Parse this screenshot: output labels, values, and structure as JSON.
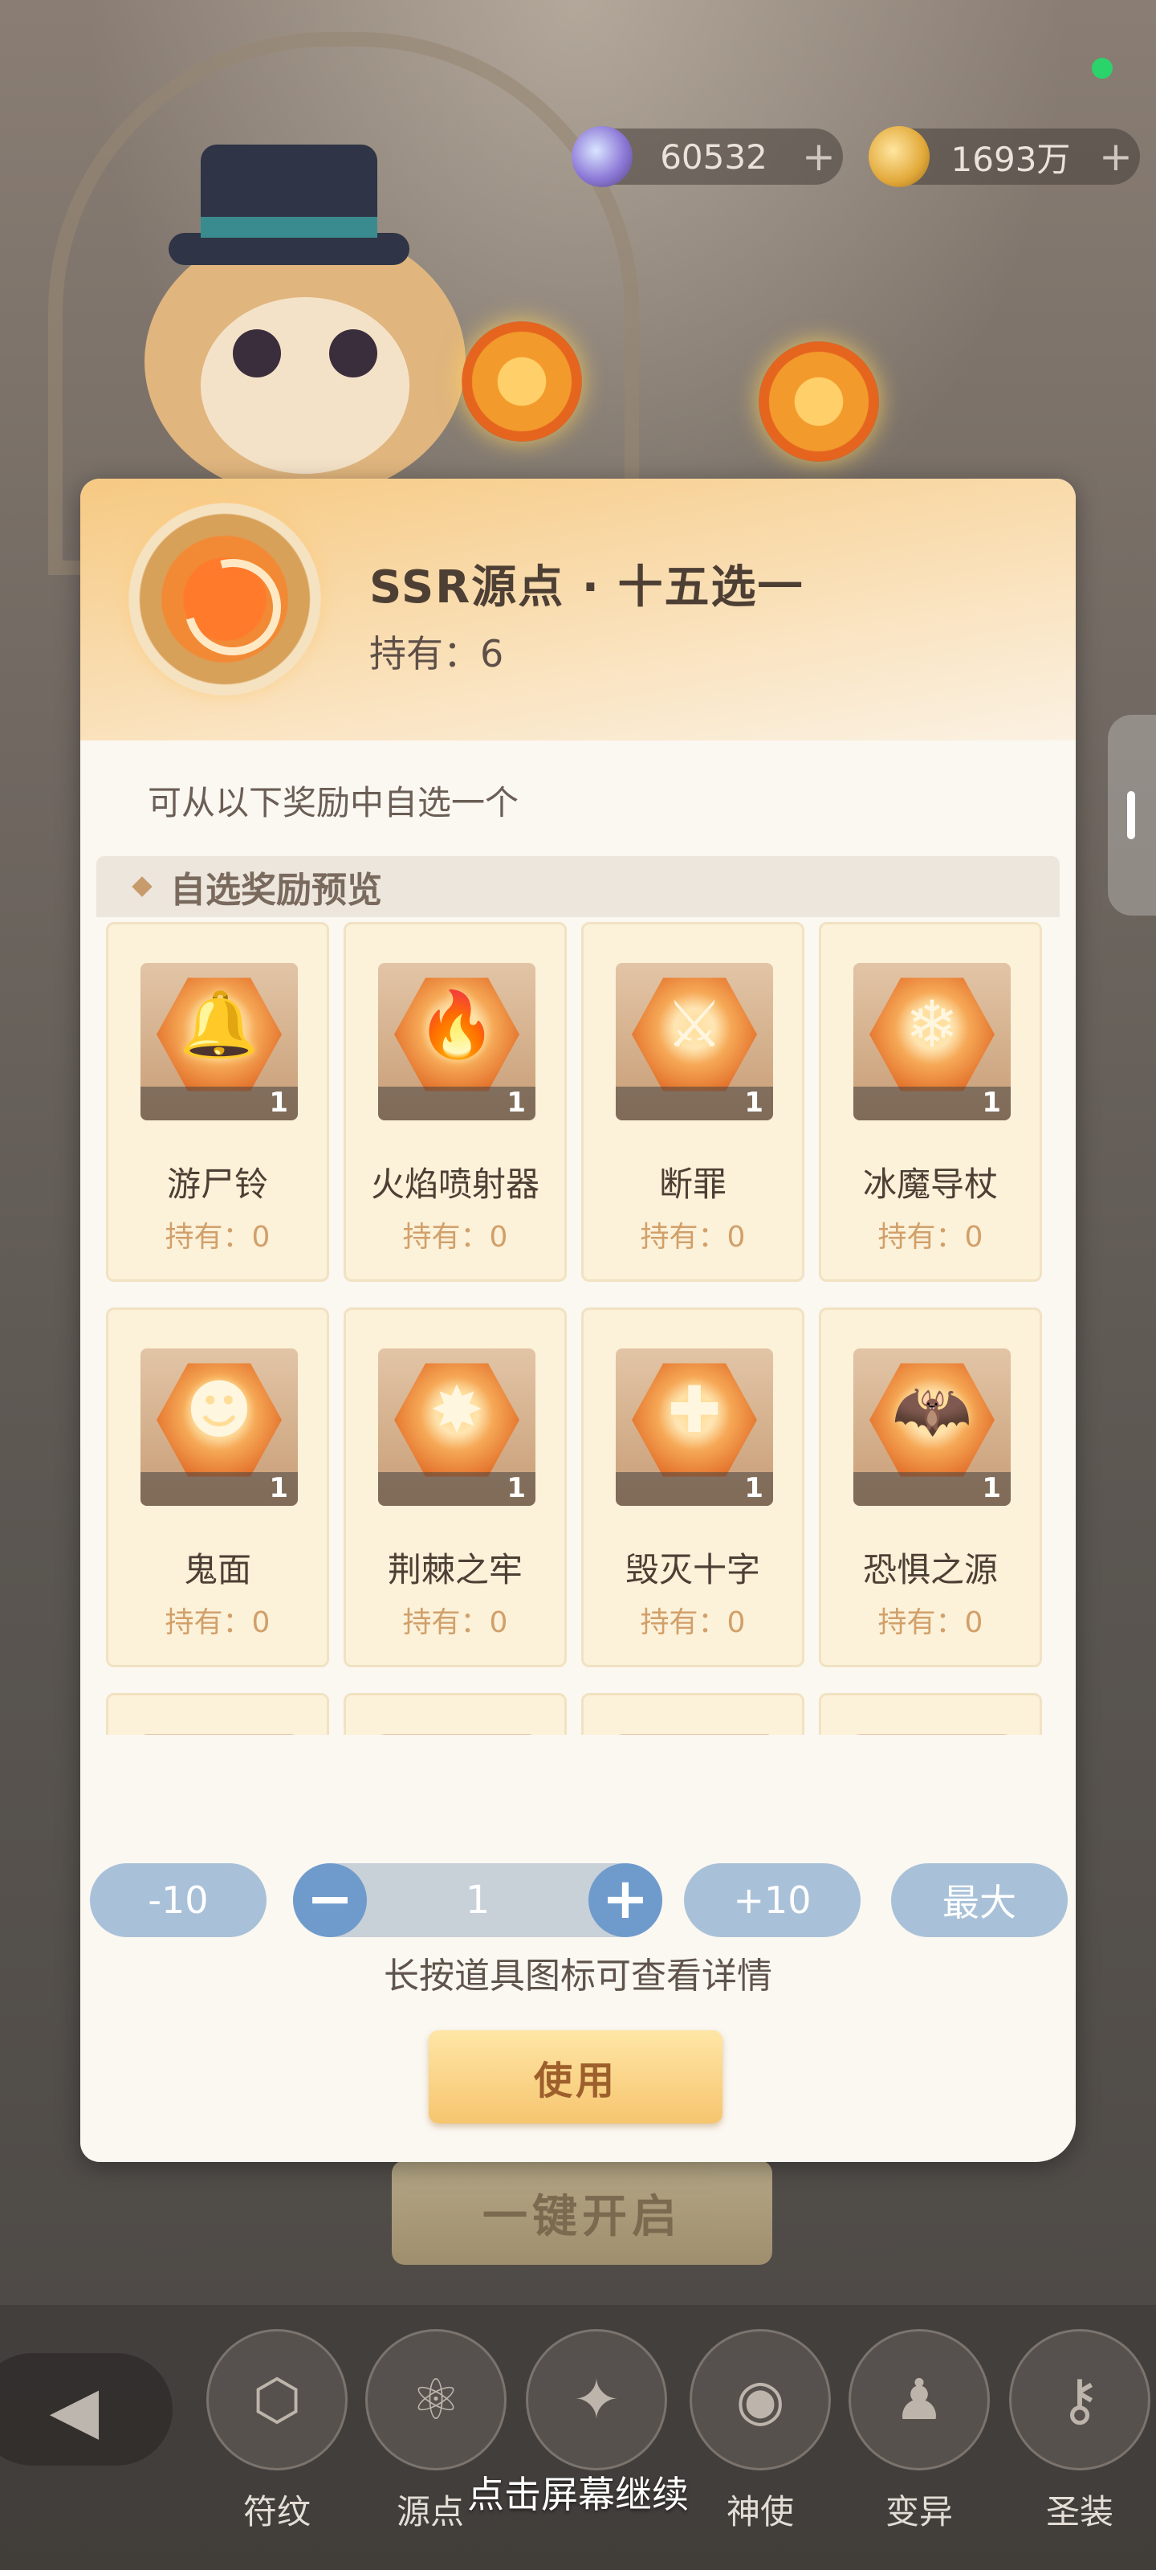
{
  "status": {
    "indicator_color": "#2bd36b"
  },
  "currencies": [
    {
      "value": "60532",
      "plus": "+",
      "icon": "crystal-icon"
    },
    {
      "value": "1693万",
      "plus": "+",
      "icon": "paw-coin-icon"
    }
  ],
  "modal": {
    "title": "SSR源点 · 十五选一",
    "owned": "持有：6",
    "subtitle": "可从以下奖励中自选一个",
    "section_title": "自选奖励预览",
    "items": [
      {
        "name": "游尸铃",
        "qty": "1",
        "owned": "持有：0",
        "glyph": "🔔"
      },
      {
        "name": "火焰喷射器",
        "qty": "1",
        "owned": "持有：0",
        "glyph": "🔥"
      },
      {
        "name": "断罪",
        "qty": "1",
        "owned": "持有：0",
        "glyph": "⚔"
      },
      {
        "name": "冰魔导杖",
        "qty": "1",
        "owned": "持有：0",
        "glyph": "❄"
      },
      {
        "name": "鬼面",
        "qty": "1",
        "owned": "持有：0",
        "glyph": "☻"
      },
      {
        "name": "荆棘之牢",
        "qty": "1",
        "owned": "持有：0",
        "glyph": "✸"
      },
      {
        "name": "毁灭十字",
        "qty": "1",
        "owned": "持有：0",
        "glyph": "✚"
      },
      {
        "name": "恐惧之源",
        "qty": "1",
        "owned": "持有：0",
        "glyph": "🦇"
      },
      {
        "name": "",
        "qty": "",
        "owned": "",
        "glyph": "✂"
      },
      {
        "name": "",
        "qty": "",
        "owned": "",
        "glyph": "☹"
      },
      {
        "name": "",
        "qty": "",
        "owned": "",
        "glyph": "◆"
      },
      {
        "name": "",
        "qty": "",
        "owned": "",
        "glyph": "⌂"
      }
    ],
    "quantity": {
      "minus10": "-10",
      "decrement": "−",
      "value": "1",
      "increment": "+",
      "plus10": "+10",
      "max": "最大"
    },
    "hint": "长按道具图标可查看详情",
    "use_label": "使用"
  },
  "background": {
    "open_all_label": "一键开启",
    "back_icon": "back-arrow-icon",
    "nav": [
      {
        "label": "符纹",
        "icon": "dice-icon"
      },
      {
        "label": "源点",
        "icon": "atom-icon"
      },
      {
        "label": "",
        "icon": "card-icon"
      },
      {
        "label": "神使",
        "icon": "eye-icon"
      },
      {
        "label": "变异",
        "icon": "mutant-icon"
      },
      {
        "label": "圣装",
        "icon": "key-icon"
      }
    ],
    "continue_text": "点击屏幕继续"
  }
}
